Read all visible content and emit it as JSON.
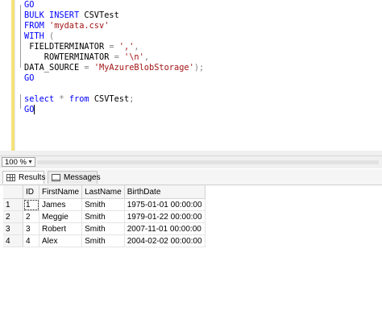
{
  "editor": {
    "lines": [
      {
        "parts": [
          {
            "t": "GO",
            "c": "kw"
          }
        ]
      },
      {
        "parts": [
          {
            "t": "BULK INSERT ",
            "c": "kw"
          },
          {
            "t": "CSVTest",
            "c": ""
          }
        ]
      },
      {
        "parts": [
          {
            "t": "FROM ",
            "c": "kw"
          },
          {
            "t": "'mydata.csv'",
            "c": "str"
          }
        ]
      },
      {
        "parts": [
          {
            "t": "WITH ",
            "c": "kw"
          },
          {
            "t": "(",
            "c": "op"
          }
        ]
      },
      {
        "parts": [
          {
            "t": " FIELDTERMINATOR ",
            "c": ""
          },
          {
            "t": "=",
            "c": "op"
          },
          {
            "t": " ",
            "c": ""
          },
          {
            "t": "','",
            "c": "str"
          },
          {
            "t": ",",
            "c": "op"
          }
        ]
      },
      {
        "parts": [
          {
            "t": "    ROWTERMINATOR ",
            "c": ""
          },
          {
            "t": "=",
            "c": "op"
          },
          {
            "t": " ",
            "c": ""
          },
          {
            "t": "'\\n'",
            "c": "str"
          },
          {
            "t": ",",
            "c": "op"
          }
        ]
      },
      {
        "parts": [
          {
            "t": "DATA_SOURCE ",
            "c": ""
          },
          {
            "t": "=",
            "c": "op"
          },
          {
            "t": " ",
            "c": ""
          },
          {
            "t": "'MyAzureBlobStorage'",
            "c": "str"
          },
          {
            "t": ");",
            "c": "op"
          }
        ]
      },
      {
        "parts": [
          {
            "t": "GO",
            "c": "kw"
          }
        ]
      },
      {
        "parts": []
      },
      {
        "parts": [
          {
            "t": "select ",
            "c": "kw"
          },
          {
            "t": "* ",
            "c": "op"
          },
          {
            "t": "from ",
            "c": "kw"
          },
          {
            "t": "CSVTest",
            "c": ""
          },
          {
            "t": ";",
            "c": "op"
          }
        ]
      },
      {
        "parts": [
          {
            "t": "GO",
            "c": "kw"
          }
        ],
        "caret": true
      }
    ]
  },
  "zoom": {
    "value": "100 %"
  },
  "tabs": {
    "results": "Results",
    "messages": "Messages"
  },
  "grid": {
    "columns": [
      "",
      "ID",
      "FirstName",
      "LastName",
      "BirthDate"
    ],
    "rows": [
      [
        "1",
        "1",
        "James",
        "Smith",
        "1975-01-01 00:00:00"
      ],
      [
        "2",
        "2",
        "Meggie",
        "Smith",
        "1979-01-22 00:00:00"
      ],
      [
        "3",
        "3",
        "Robert",
        "Smith",
        "2007-11-01 00:00:00"
      ],
      [
        "4",
        "4",
        "Alex",
        "Smith",
        "2004-02-02 00:00:00"
      ]
    ]
  }
}
